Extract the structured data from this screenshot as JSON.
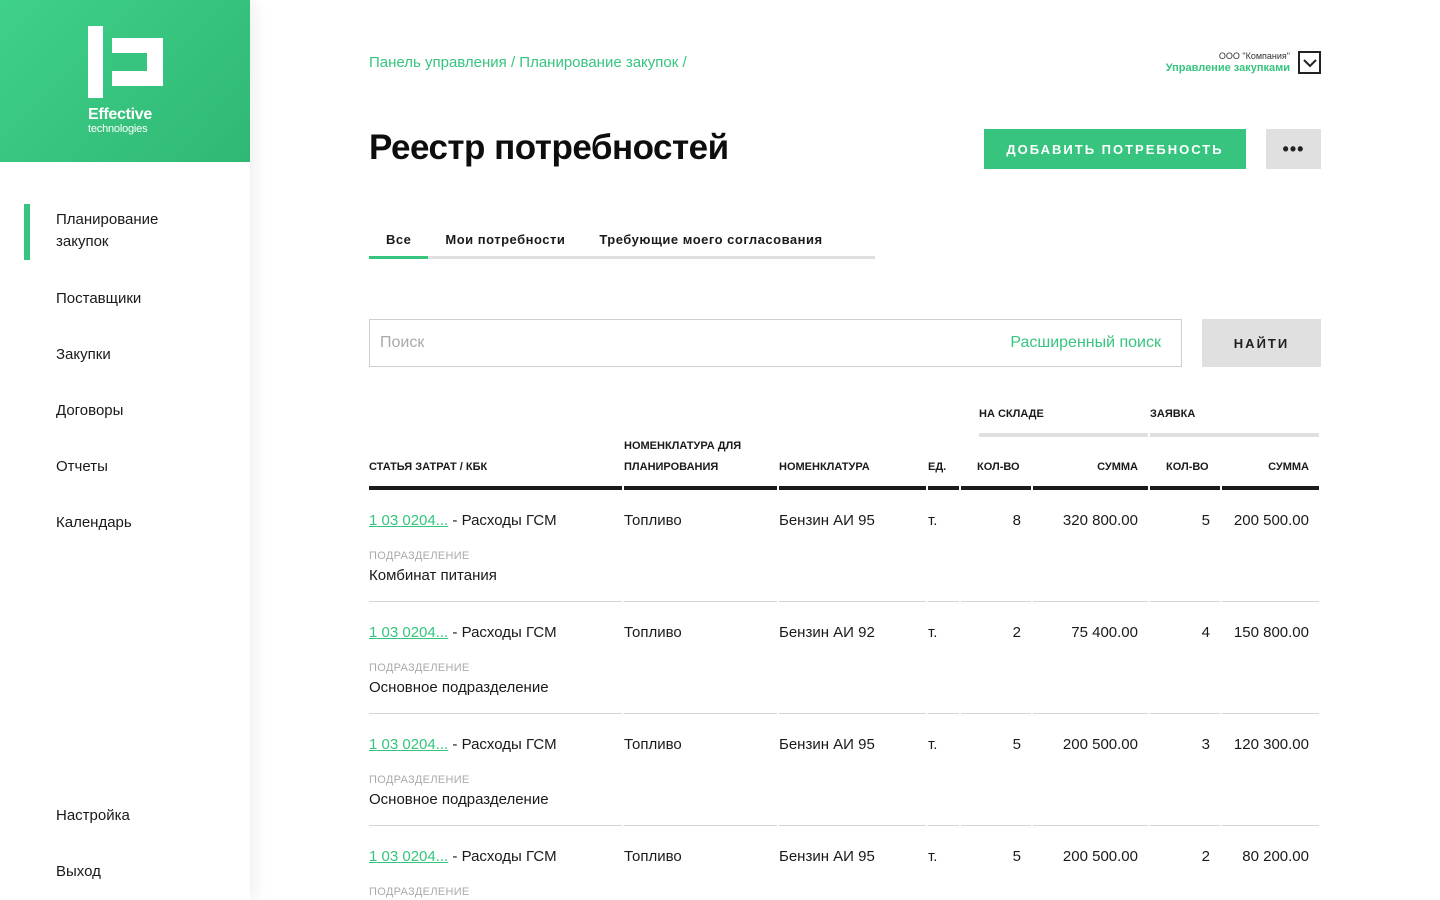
{
  "logo": {
    "name": "Effective",
    "tagline": "technologies"
  },
  "sidebar": {
    "items": [
      {
        "label": "Планирование закупок",
        "active": true
      },
      {
        "label": "Поставщики"
      },
      {
        "label": "Закупки"
      },
      {
        "label": "Договоры"
      },
      {
        "label": "Отчеты"
      },
      {
        "label": "Календарь"
      }
    ],
    "bottom": [
      {
        "label": "Настройка"
      },
      {
        "label": "Выход"
      }
    ]
  },
  "header": {
    "breadcrumb": "Панель управления / Планирование закупок /",
    "company_name": "ООО \"Компания\"",
    "company_role": "Управление закупками"
  },
  "page": {
    "title": "Реестр потребностей",
    "add_button": "ДОБАВИТЬ ПОТРЕБНОСТЬ",
    "more_button": "•••"
  },
  "tabs": [
    {
      "label": "Все",
      "active": true
    },
    {
      "label": "Мои потребности"
    },
    {
      "label": "Требующие моего согласования"
    }
  ],
  "search": {
    "placeholder": "Поиск",
    "advanced": "Расширенный поиск",
    "button": "НАЙТИ"
  },
  "table": {
    "groups": {
      "warehouse": "НА СКЛАДЕ",
      "request": "ЗАЯВКА"
    },
    "columns": {
      "cost_item": "СТАТЬЯ ЗАТРАТ / КБК",
      "plan_nomenclature_1": "НОМЕНКЛАТУРА ДЛЯ",
      "plan_nomenclature_2": "ПЛАНИРОВАНИЯ",
      "nomenclature": "НОМЕНКЛАТУРА",
      "unit": "ЕД.",
      "qty": "КОЛ-ВО",
      "sum": "СУММА",
      "req_qty": "КОЛ-ВО",
      "req_sum": "СУММА"
    },
    "sublabel": "ПОДРАЗДЕЛЕНИЕ",
    "rows": [
      {
        "code": "1 03 0204...",
        "cost": " - Расходы ГСМ",
        "plan": "Топливо",
        "nom": "Бензин АИ 95",
        "unit": "т.",
        "qty": "8",
        "sum": "320 800.00",
        "rqty": "5",
        "rsum": "200 500.00",
        "dept": "Комбинат питания"
      },
      {
        "code": "1 03 0204...",
        "cost": " - Расходы ГСМ",
        "plan": "Топливо",
        "nom": "Бензин АИ 92",
        "unit": "т.",
        "qty": "2",
        "sum": "75 400.00",
        "rqty": "4",
        "rsum": "150 800.00",
        "dept": "Основное подразделение"
      },
      {
        "code": "1 03 0204...",
        "cost": " - Расходы ГСМ",
        "plan": "Топливо",
        "nom": "Бензин АИ 95",
        "unit": "т.",
        "qty": "5",
        "sum": "200 500.00",
        "rqty": "3",
        "rsum": "120 300.00",
        "dept": "Основное подразделение"
      },
      {
        "code": "1 03 0204...",
        "cost": " - Расходы ГСМ",
        "plan": "Топливо",
        "nom": "Бензин АИ 95",
        "unit": "т.",
        "qty": "5",
        "sum": "200 500.00",
        "rqty": "2",
        "rsum": "80 200.00",
        "dept": ""
      }
    ]
  }
}
